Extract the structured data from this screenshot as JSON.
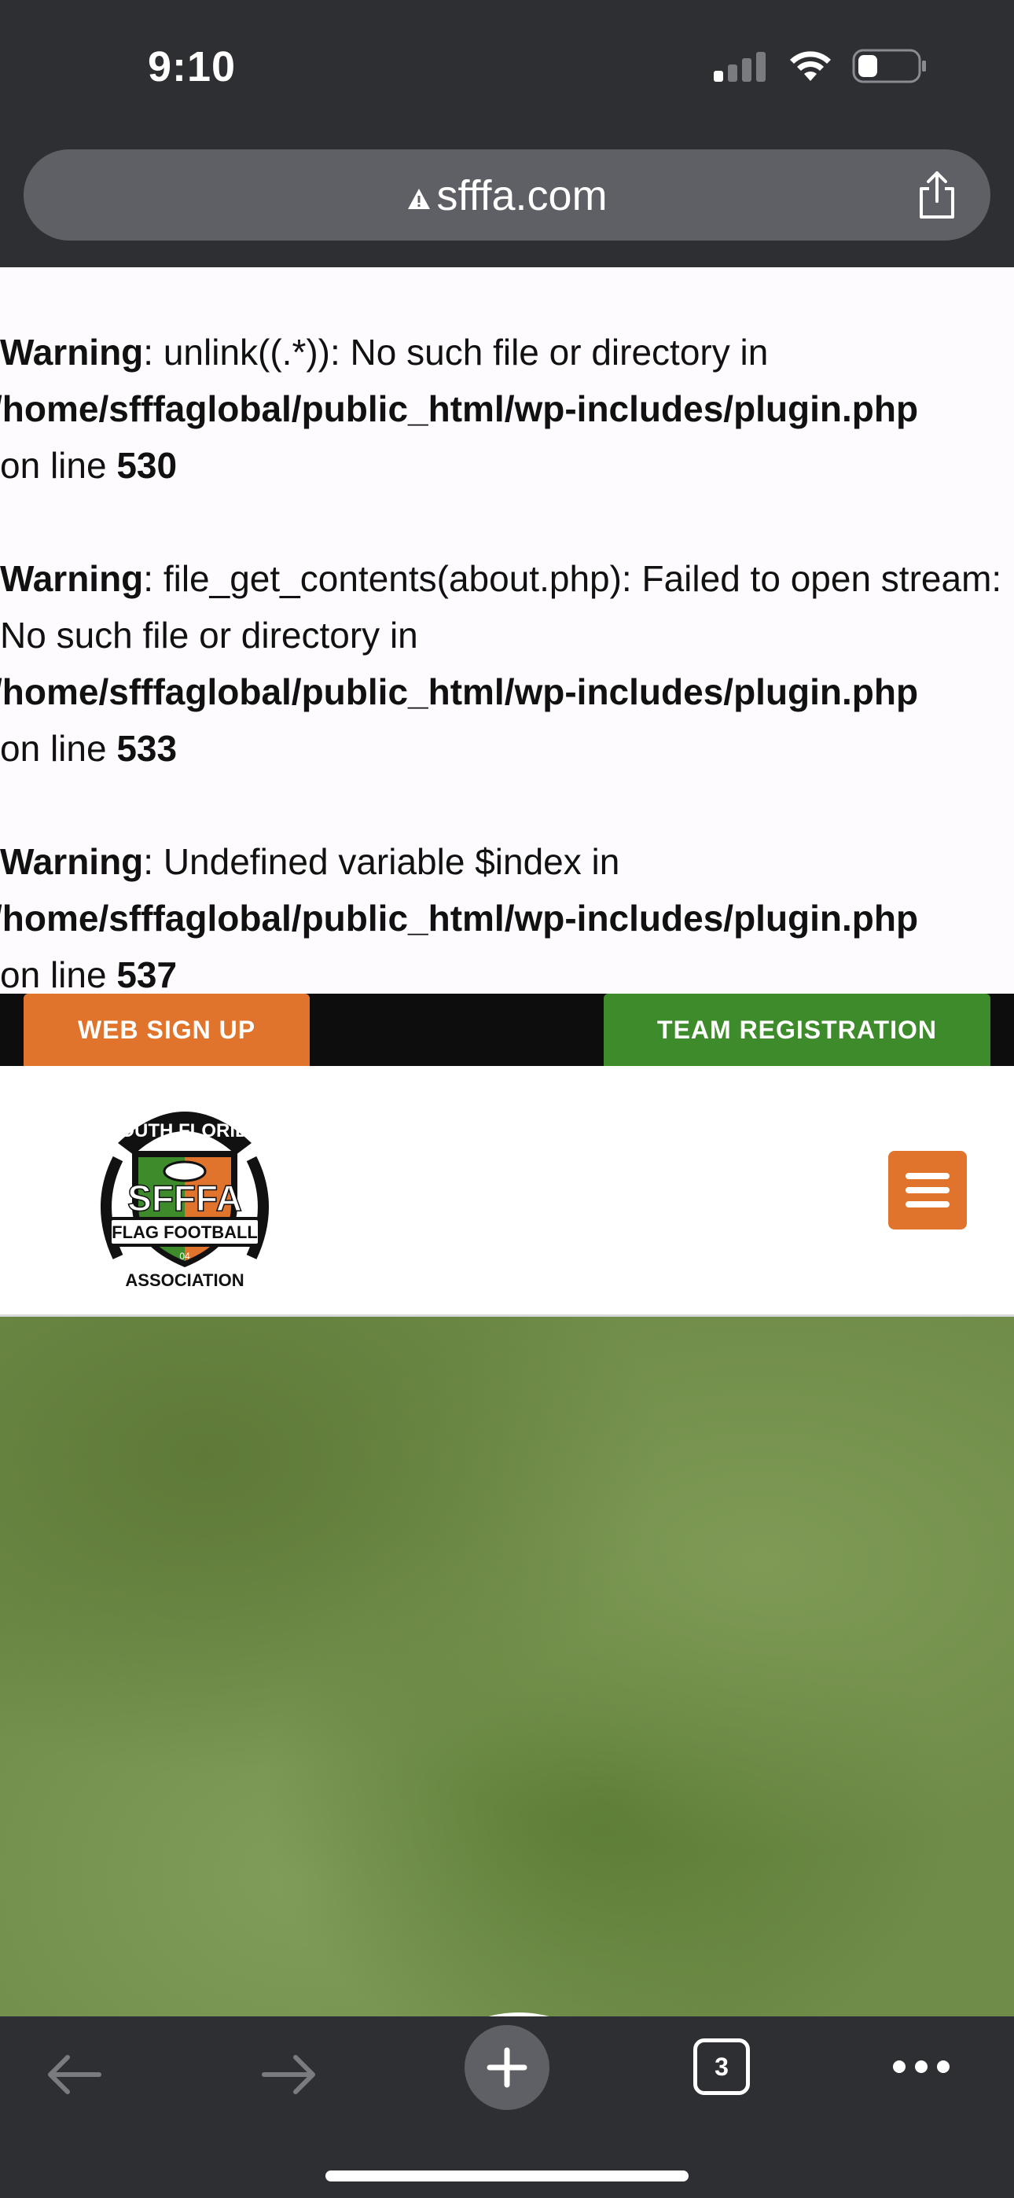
{
  "status_bar": {
    "time": "9:10"
  },
  "browser": {
    "url": "sfffa.com",
    "tabs_count": "3"
  },
  "warnings": [
    {
      "label": "Warning",
      "message": ": unlink((.*)): No such file or directory in",
      "path": "/home/sfffaglobal/public_html/wp-includes/plugin.php",
      "line_prefix": "on line ",
      "line": "530"
    },
    {
      "label": "Warning",
      "message": ": file_get_contents(about.php): Failed to open stream: No such file or directory in",
      "path": "/home/sfffaglobal/public_html/wp-includes/plugin.php",
      "line_prefix": "on line ",
      "line": "533"
    },
    {
      "label": "Warning",
      "message": ": Undefined variable $index in",
      "path": "/home/sfffaglobal/public_html/wp-includes/plugin.php",
      "line_prefix": "on line ",
      "line": "537"
    }
  ],
  "action_bar": {
    "web_signup": "WEB SIGN UP",
    "team_registration": "TEAM REGISTRATION"
  },
  "logo": {
    "top_text": "SOUTH FLORIDA",
    "main_text": "SFFFA",
    "banner_text": "FLAG FOOTBALL",
    "bottom_text": "ASSOCIATION",
    "est": "04"
  },
  "colors": {
    "orange": "#e0742c",
    "green": "#3d8b2a",
    "chrome": "#2e2f33"
  }
}
